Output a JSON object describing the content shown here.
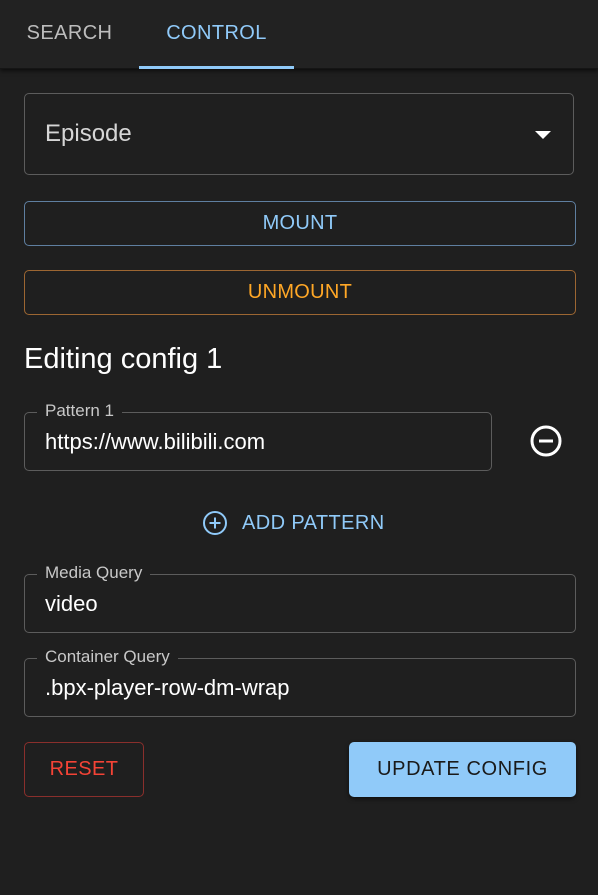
{
  "tabs": [
    {
      "label": "SEARCH"
    },
    {
      "label": "CONTROL"
    }
  ],
  "episode_select": {
    "value": "Episode"
  },
  "buttons": {
    "mount": "MOUNT",
    "unmount": "UNMOUNT",
    "add_pattern": "ADD PATTERN",
    "reset": "RESET",
    "update_config": "UPDATE CONFIG"
  },
  "heading": "Editing config 1",
  "fields": {
    "pattern1": {
      "label": "Pattern 1",
      "value": "https://www.bilibili.com"
    },
    "media_query": {
      "label": "Media Query",
      "value": "video"
    },
    "container_query": {
      "label": "Container Query",
      "value": ".bpx-player-row-dm-wrap"
    }
  },
  "icons": {
    "remove_pattern": "minus-circle-icon",
    "add_pattern": "plus-circle-icon",
    "select_caret": "caret-down-icon"
  },
  "colors": {
    "accent": "#90caf9",
    "warning": "#ffa726",
    "error": "#f44336",
    "background": "#1f1f1f"
  }
}
